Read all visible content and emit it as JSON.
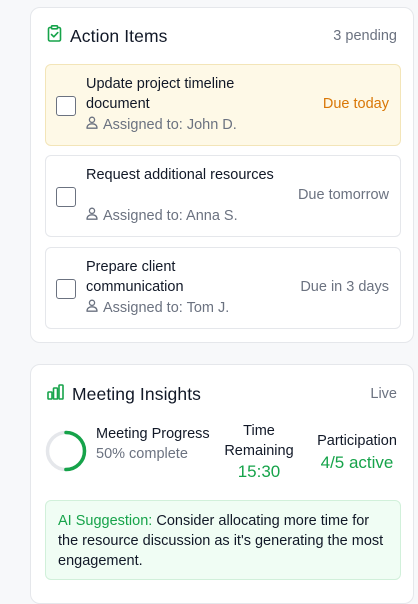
{
  "action_items": {
    "title": "Action Items",
    "pending": "3 pending",
    "tasks": [
      {
        "title": "Update project timeline document",
        "assignee": "Assigned to: John D.",
        "due": "Due today"
      },
      {
        "title": "Request additional resources",
        "assignee": "Assigned to: Anna S.",
        "due": "Due tomorrow"
      },
      {
        "title": "Prepare client communication",
        "assignee": "Assigned to: Tom J.",
        "due": "Due in 3 days"
      }
    ]
  },
  "insights": {
    "title": "Meeting Insights",
    "status": "Live",
    "progress_label": "Meeting Progress",
    "progress_text": "50% complete",
    "progress_fraction": 0.5,
    "time_label": "Time Remaining",
    "time_value": "15:30",
    "participation_label": "Participation",
    "participation_value": "4/5 active",
    "ai_label": "AI Suggestion:",
    "ai_text": "Consider allocating more time for the resource discussion as it's generating the most engagement."
  },
  "colors": {
    "accent_green": "#16a34a",
    "due_today": "#d97706",
    "highlight_bg": "#fef9e7",
    "suggestion_bg": "#f0fdf4"
  },
  "icons": {
    "action_items": "clipboard-check-icon",
    "insights": "bar-chart-icon",
    "assignee": "user-icon"
  }
}
